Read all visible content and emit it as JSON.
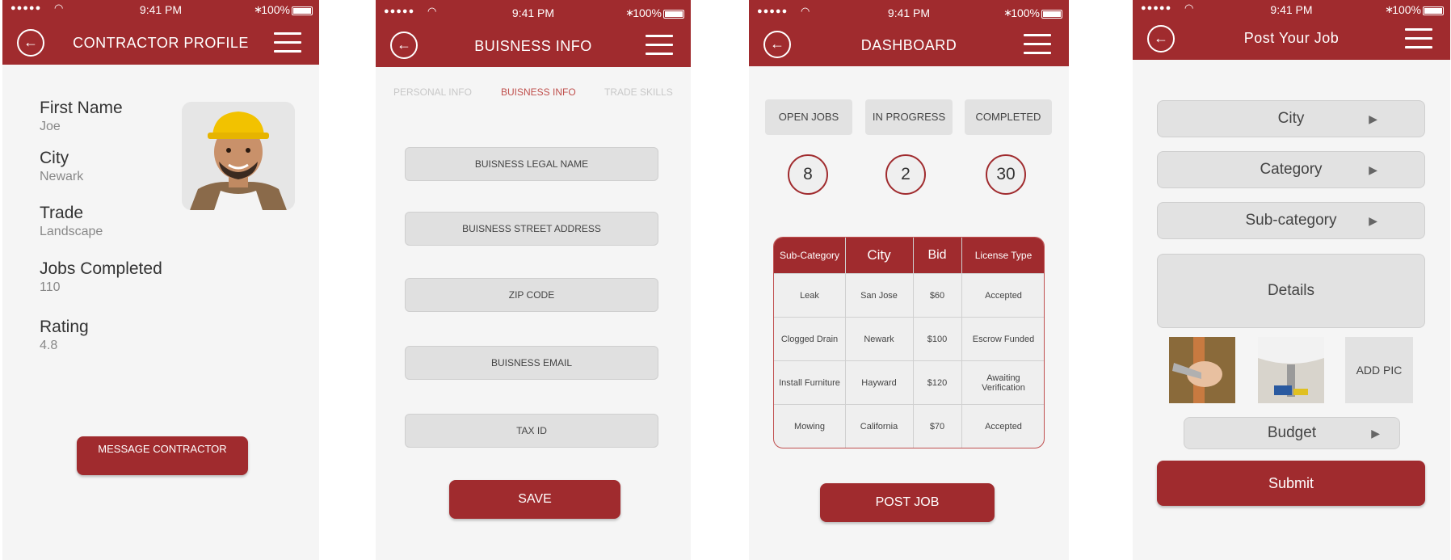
{
  "status_bar": {
    "signal": "●●●●●",
    "time": "9:41 PM",
    "bluetooth": "∗",
    "battery": "100%"
  },
  "icons": {
    "back": "left-arrow-circle",
    "menu": "hamburger",
    "dropdown": "triangle-right"
  },
  "colors": {
    "primary": "#a02b2e",
    "background": "#f5f5f5",
    "field": "#e0e0e0"
  },
  "profile_screen": {
    "title": "CONTRACTOR PROFILE",
    "fields": [
      {
        "label": "First Name",
        "value": "Joe"
      },
      {
        "label": "City",
        "value": "Newark"
      },
      {
        "label": "Trade",
        "value": "Landscape"
      },
      {
        "label": "Jobs Completed",
        "value": "110"
      },
      {
        "label": "Rating",
        "value": "4.8"
      }
    ],
    "message_button": "MESSAGE CONTRACTOR"
  },
  "business_screen": {
    "title": "BUISNESS INFO",
    "tabs": [
      "PERSONAL INFO",
      "BUISNESS INFO",
      "TRADE SKILLS"
    ],
    "active_tab": "BUISNESS INFO",
    "fields": [
      "BUISNESS LEGAL NAME",
      "BUISNESS STREET ADDRESS",
      "ZIP CODE",
      "BUISNESS EMAIL",
      "TAX ID"
    ],
    "save_button": "SAVE"
  },
  "dashboard_screen": {
    "title": "DASHBOARD",
    "stats": [
      {
        "label": "OPEN JOBS",
        "count": "8"
      },
      {
        "label": "IN PROGRESS",
        "count": "2"
      },
      {
        "label": "COMPLETED",
        "count": "30"
      }
    ],
    "table": {
      "headers": [
        "Sub-Category",
        "City",
        "Bid",
        "License Type"
      ],
      "rows": [
        [
          "Leak",
          "San Jose",
          "$60",
          "Accepted"
        ],
        [
          "Clogged Drain",
          "Newark",
          "$100",
          "Escrow Funded"
        ],
        [
          "Install Furniture",
          "Hayward",
          "$120",
          "Awaiting Verification"
        ],
        [
          "Mowing",
          "California",
          "$70",
          "Accepted"
        ]
      ]
    },
    "post_job_button": "POST JOB"
  },
  "post_job_screen": {
    "title": "Post Your Job",
    "city": "City",
    "category": "Category",
    "subcategory": "Sub-category",
    "details": "Details",
    "add_pic": "ADD PIC",
    "budget": "Budget",
    "submit": "Submit"
  }
}
